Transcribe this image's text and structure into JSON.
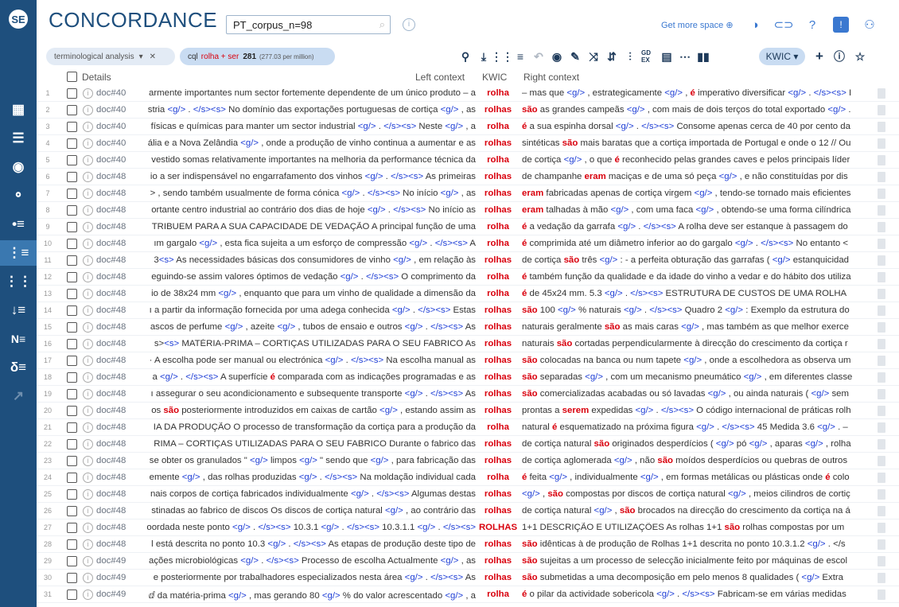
{
  "app": {
    "brand": "CONCORDANCE",
    "corpus": "PT_corpus_n=98",
    "get_more_space": "Get more space ⊕"
  },
  "sidebar": [
    "dashboard-icon",
    "list-icon",
    "target-icon",
    "wordlist-icon",
    "keywords-icon",
    "concordance-icon",
    "parconc-icon",
    "sort-icon",
    "ngram-icon",
    "collocation-icon",
    "trends-icon"
  ],
  "query": {
    "analysis": "terminological analysis",
    "cql_prefix": "cql",
    "cql": "rolha + ser",
    "hits": "281",
    "per_million": "(277.03 per million)"
  },
  "view": {
    "mode": "KWIC ▾"
  },
  "columns": {
    "details": "Details",
    "left": "Left context",
    "kwic": "KWIC",
    "right": "Right context"
  },
  "rows": [
    {
      "n": "1",
      "doc": "doc#40",
      "left": "armente importantes num sector fortemente dependente de um único produto – a",
      "kwic": "rolha",
      "right": "– mas que <g/> , estrategicamente <g/> , é imperativo diversificar <g/> . </s><s> I"
    },
    {
      "n": "2",
      "doc": "doc#40",
      "left": "stria <g/> . </s><s> No domínio das exportações portuguesas de cortiça <g/> , as",
      "kwic": "rolhas",
      "right": "são as grandes campeãs <g/> , com mais de dois terços do total exportado <g/> ."
    },
    {
      "n": "3",
      "doc": "doc#40",
      "left": "físicas e químicas para manter um sector industrial <g/> . </s><s> Neste <g/> , a",
      "kwic": "rolha",
      "right": "é a sua espinha dorsal <g/> . </s><s> Consome apenas cerca de 40 por cento da"
    },
    {
      "n": "4",
      "doc": "doc#40",
      "left": "ália e a Nova Zelândia <g/> , onde a produção de vinho continua a aumentar e as",
      "kwic": "rolhas",
      "right": "sintéticas são mais baratas que a cortiça importada de Portugal e onde o 12 // Ou"
    },
    {
      "n": "5",
      "doc": "doc#40",
      "left": "vestido somas relativamente importantes na melhoria da performance técnica da",
      "kwic": "rolha",
      "right": "de cortiça <g/> , o que é reconhecido pelas grandes caves e pelos principais líder"
    },
    {
      "n": "6",
      "doc": "doc#48",
      "left": "io a ser indispensável no engarrafamento dos vinhos <g/> . </s><s> As primeiras",
      "kwic": "rolhas",
      "right": "de champanhe eram maciças e de uma só peça <g/> , e não constituídas por dis"
    },
    {
      "n": "7",
      "doc": "doc#48",
      "left": "> , sendo também usualmente de forma cónica <g/> . </s><s> No início <g/> , as",
      "kwic": "rolhas",
      "right": "eram fabricadas apenas de cortiça virgem <g/> , tendo-se tornado mais eficientes"
    },
    {
      "n": "8",
      "doc": "doc#48",
      "left": "ortante centro industrial ao contrário dos dias de hoje <g/> . </s><s> No início as",
      "kwic": "rolhas",
      "right": "eram talhadas à mão <g/> , com uma faca <g/> , obtendo-se uma forma cilíndrica"
    },
    {
      "n": "9",
      "doc": "doc#48",
      "left": "TRIBUEM PARA A SUA CAPACIDADE DE VEDAÇÃO A principal função de uma",
      "kwic": "rolha",
      "right": "é a vedação da garrafa <g/> . </s><s> A rolha deve ser estanque à passagem do"
    },
    {
      "n": "10",
      "doc": "doc#48",
      "left": "ım gargalo <g/> , esta fica sujeita a um esforço de compressão <g/> . </s><s> A",
      "kwic": "rolha",
      "right": "é comprimida até um diâmetro inferior ao do gargalo <g/> . </s><s> No entanto <"
    },
    {
      "n": "11",
      "doc": "doc#48",
      "left": "3<s> As necessidades básicas dos consumidores de vinho <g/> , em relação às",
      "kwic": "rolhas",
      "right": "de cortiça são três <g/> : - a perfeita obturação das garrafas ( <g/> estanquicidad"
    },
    {
      "n": "12",
      "doc": "doc#48",
      "left": "eguindo-se assim valores óptimos de vedação <g/> . </s><s> O comprimento da",
      "kwic": "rolha",
      "right": "é também função da qualidade e da idade do vinho a vedar e do hábito dos utiliza"
    },
    {
      "n": "13",
      "doc": "doc#48",
      "left": "io de 38x24 mm <g/> , enquanto que para um vinho de qualidade a dimensão da",
      "kwic": "rolha",
      "right": "é de 45x24 mm. 5.3 <g/> . </s><s> ESTRUTURA DE CUSTOS DE UMA ROLHA"
    },
    {
      "n": "14",
      "doc": "doc#48",
      "left": "ı a partir da informação fornecida por uma adega conhecida <g/> . </s><s> Estas",
      "kwic": "rolhas",
      "right": "são 100 <g/> % naturais <g/> . </s><s> Quadro 2 <g/> : Exemplo da estrutura do"
    },
    {
      "n": "15",
      "doc": "doc#48",
      "left": "ascos de perfume <g/> , azeite <g/> , tubos de ensaio e outros <g/> . </s><s> As",
      "kwic": "rolhas",
      "right": "naturais geralmente são as mais caras <g/> , mas também as que melhor exerce"
    },
    {
      "n": "16",
      "doc": "doc#48",
      "left": "s><s> MATÉRIA-PRIMA – CORTIÇAS UTILIZADAS PARA O SEU FABRICO As",
      "kwic": "rolhas",
      "right": "naturais são cortadas perpendicularmente à direcção do crescimento da cortiça r"
    },
    {
      "n": "17",
      "doc": "doc#48",
      "left": "· A escolha pode ser manual ou electrónica <g/> . </s><s> Na escolha manual as",
      "kwic": "rolhas",
      "right": "são colocadas na banca ou num tapete <g/> , onde a escolhedora as observa um"
    },
    {
      "n": "18",
      "doc": "doc#48",
      "left": "a <g/> . </s><s> A superfície é comparada com as indicações programadas e as",
      "kwic": "rolhas",
      "right": "são separadas <g/> , com um mecanismo pneumático <g/> , em diferentes classe"
    },
    {
      "n": "19",
      "doc": "doc#48",
      "left": "ı assegurar o seu acondicionamento e subsequente transporte <g/> . </s><s> As",
      "kwic": "rolhas",
      "right": "são comercializadas acabadas ou só lavadas <g/> , ou ainda naturais ( <g/> sem"
    },
    {
      "n": "20",
      "doc": "doc#48",
      "left": "os são posteriormente introduzidos em caixas de cartão <g/> , estando assim as",
      "kwic": "rolhas",
      "right": "prontas a serem expedidas <g/> . </s><s> O código internacional de práticas rolh"
    },
    {
      "n": "21",
      "doc": "doc#48",
      "left": "IA DA PRODUÇÃO O processo de transformação da cortiça para a produção da",
      "kwic": "rolha",
      "right": "natural é esquematizado na próxima figura <g/> . </s><s> 45 Medida 3.6 <g/> . –"
    },
    {
      "n": "22",
      "doc": "doc#48",
      "left": "RIMA – CORTIÇAS UTILIZADAS PARA O SEU FABRICO Durante o fabrico das",
      "kwic": "rolhas",
      "right": "de cortiça natural são originados desperdícios ( <g/> pó <g/> , aparas <g/> , rolha"
    },
    {
      "n": "23",
      "doc": "doc#48",
      "left": "se obter os granulados \" <g/> limpos <g/> \" sendo que <g/> , para fabricação das",
      "kwic": "rolhas",
      "right": "de cortiça aglomerada <g/> , não são moídos desperdícios ou quebras de outros"
    },
    {
      "n": "24",
      "doc": "doc#48",
      "left": "emente <g/> , das rolhas produzidas <g/> . </s><s> Na moldação individual cada",
      "kwic": "rolha",
      "right": "é feita <g/> , individualmente <g/> , em formas metálicas ou plásticas onde é colo"
    },
    {
      "n": "25",
      "doc": "doc#48",
      "left": "nais corpos de cortiça fabricados individualmente <g/> . </s><s> Algumas destas",
      "kwic": "rolhas",
      "right": "<g/> , são compostas por discos de cortiça natural <g/> , meios cilindros de cortiç"
    },
    {
      "n": "26",
      "doc": "doc#48",
      "left": "stinadas ao fabrico de discos Os discos de cortiça natural <g/> , ao contrário das",
      "kwic": "rolhas",
      "right": "de cortiça natural <g/> , são brocados na direcção do crescimento da cortiça na á"
    },
    {
      "n": "27",
      "doc": "doc#48",
      "left": "oordada neste ponto <g/> . </s><s> 10.3.1 <g/> . </s><s> 10.3.1.1 <g/> . </s><s>",
      "kwic": "ROLHAS",
      "right": "1+1 DESCRIÇÃO E UTILIZAÇÕES As rolhas 1+1 são rolhas compostas por um"
    },
    {
      "n": "28",
      "doc": "doc#48",
      "left": "l está descrita no ponto 10.3 <g/> . </s><s> As etapas de produção deste tipo de",
      "kwic": "rolhas",
      "right": "são idênticas à de produção de Rolhas 1+1 descrita no ponto 10.3.1.2 <g/> . </s"
    },
    {
      "n": "29",
      "doc": "doc#49",
      "left": "ações microbiológicas <g/> . </s><s> Processo de escolha Actualmente <g/> , as",
      "kwic": "rolhas",
      "right": "são sujeitas a um processo de selecção inicialmente feito por máquinas de escol"
    },
    {
      "n": "30",
      "doc": "doc#49",
      "left": "e posteriormente por trabalhadores especializados nesta área <g/> . </s><s> As",
      "kwic": "rolhas",
      "right": "são submetidas a uma decomposição em pelo menos 8 qualidades ( <g/> Extra"
    },
    {
      "n": "31",
      "doc": "doc#49",
      "left": "ⅆ da matéria-prima <g/> , mas gerando 80 <g/> % do valor acrescentado <g/> , a",
      "kwic": "rolha",
      "right": "é o pilar da actividade sobericola <g/> . </s><s> Fabricam-se em várias medidas"
    }
  ]
}
